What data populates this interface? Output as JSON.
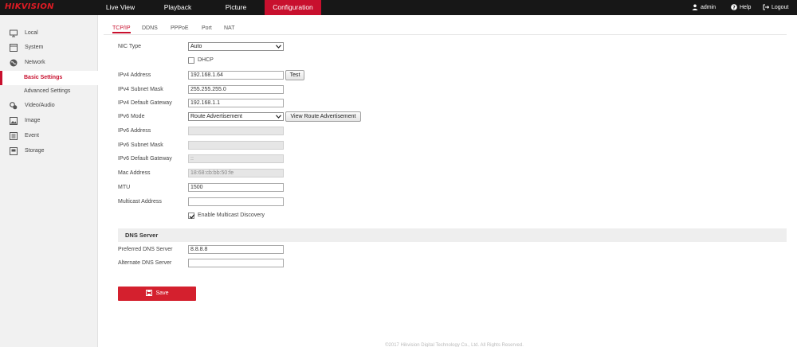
{
  "brand": {
    "logo": "HIKVISION"
  },
  "nav": {
    "tabs": [
      {
        "label": "Live View"
      },
      {
        "label": "Playback"
      },
      {
        "label": "Picture"
      },
      {
        "label": "Configuration",
        "active": true
      }
    ],
    "user": "admin",
    "help": "Help",
    "logout": "Logout"
  },
  "sidebar": {
    "items": [
      {
        "label": "Local",
        "icon": "monitor-icon"
      },
      {
        "label": "System",
        "icon": "system-icon"
      },
      {
        "label": "Network",
        "icon": "globe-icon"
      },
      {
        "label": "Basic Settings",
        "selected": true
      },
      {
        "label": "Advanced Settings"
      },
      {
        "label": "Video/Audio",
        "icon": "video-audio-icon"
      },
      {
        "label": "Image",
        "icon": "image-icon"
      },
      {
        "label": "Event",
        "icon": "event-icon"
      },
      {
        "label": "Storage",
        "icon": "storage-icon"
      }
    ]
  },
  "subtabs": [
    "TCP/IP",
    "DDNS",
    "PPPoE",
    "Port",
    "NAT"
  ],
  "form": {
    "nic_type": {
      "label": "NIC Type",
      "value": "Auto"
    },
    "dhcp": {
      "label": "DHCP",
      "checked": false
    },
    "ipv4_address": {
      "label": "IPv4 Address",
      "value": "192.168.1.64"
    },
    "test_button": "Test",
    "ipv4_mask": {
      "label": "IPv4 Subnet Mask",
      "value": "255.255.255.0"
    },
    "ipv4_gateway": {
      "label": "IPv4 Default Gateway",
      "value": "192.168.1.1"
    },
    "ipv6_mode": {
      "label": "IPv6 Mode",
      "value": "Route Advertisement"
    },
    "view_route_button": "View Route Advertisement",
    "ipv6_address": {
      "label": "IPv6 Address",
      "value": ""
    },
    "ipv6_mask": {
      "label": "IPv6 Subnet Mask",
      "value": ""
    },
    "ipv6_gateway": {
      "label": "IPv6 Default Gateway",
      "value": "::"
    },
    "mac_address": {
      "label": "Mac Address",
      "value": "18:68:cb:bb:50:fe"
    },
    "mtu": {
      "label": "MTU",
      "value": "1500"
    },
    "multicast_address": {
      "label": "Multicast Address",
      "value": ""
    },
    "multicast_discovery": {
      "label": "Enable Multicast Discovery",
      "checked": true
    }
  },
  "dns": {
    "section_title": "DNS Server",
    "preferred": {
      "label": "Preferred DNS Server",
      "value": "8.8.8.8"
    },
    "alternate": {
      "label": "Alternate DNS Server",
      "value": ""
    }
  },
  "save_button": "Save",
  "footer": "©2017 Hikvision Digital Technology Co., Ltd. All Rights Reserved.",
  "colors": {
    "accent": "#c8102e",
    "topbar": "#171717",
    "sidebar": "#f1f1f1"
  }
}
